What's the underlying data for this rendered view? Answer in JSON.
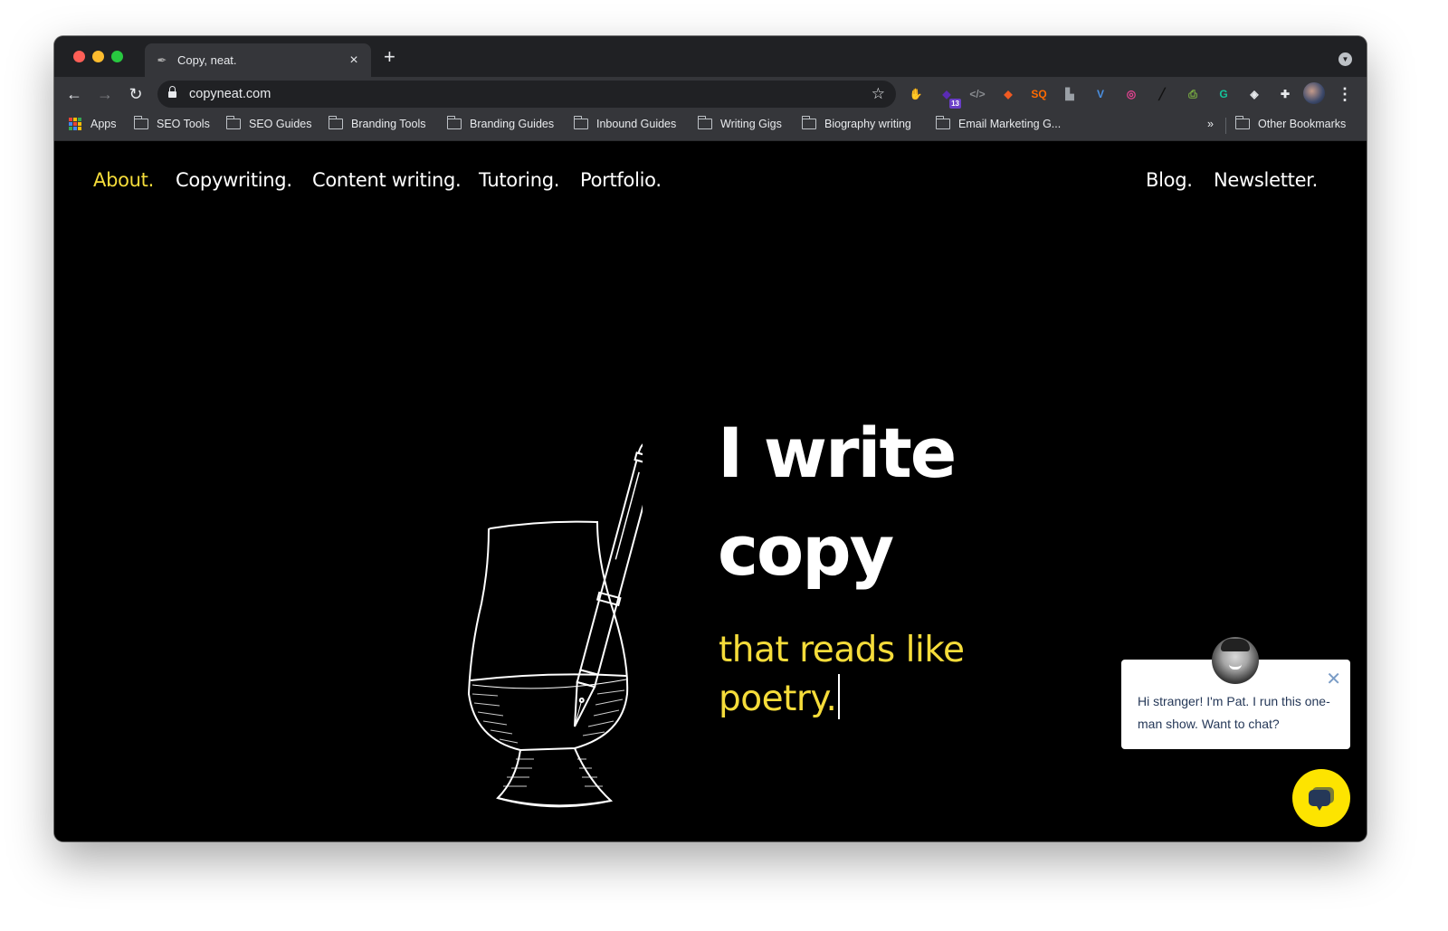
{
  "browser": {
    "tab": {
      "title": "Copy, neat.",
      "favicon": "pen-glass-icon",
      "close_label": "×"
    },
    "new_tab_label": "+",
    "address_bar": {
      "url": "copyneat.com",
      "secure": true
    },
    "nav": {
      "back": "←",
      "forward": "→",
      "reload": "↻"
    },
    "star_label": "☆",
    "extensions": [
      {
        "name": "adblock-icon",
        "glyph": "✋",
        "color": "#e0201b"
      },
      {
        "name": "stack-extension-icon",
        "glyph": "◆",
        "color": "#5b2bb5",
        "badge": "13"
      },
      {
        "name": "code-extension-icon",
        "glyph": "</>",
        "color": "#8a8d91"
      },
      {
        "name": "fox-extension-icon",
        "glyph": "◆",
        "color": "#f05a22"
      },
      {
        "name": "sq-extension-icon",
        "glyph": "SQ",
        "color": "#ff6a00"
      },
      {
        "name": "puzzle-blocks-icon",
        "glyph": "▙",
        "color": "#9aa0a6"
      },
      {
        "name": "v-extension-icon",
        "glyph": "V",
        "color": "#4a90e2"
      },
      {
        "name": "color-ring-icon",
        "glyph": "◎",
        "color": "#e84393"
      },
      {
        "name": "pen-extension-icon",
        "glyph": "╱",
        "color": "#111111"
      },
      {
        "name": "print-extension-icon",
        "glyph": "⎙",
        "color": "#7cb342"
      },
      {
        "name": "grammarly-icon",
        "glyph": "G",
        "color": "#15c39a"
      },
      {
        "name": "tag-extension-icon",
        "glyph": "◈",
        "color": "#e8eaed"
      },
      {
        "name": "extensions-puzzle-icon",
        "glyph": "✚",
        "color": "#e8eaed"
      }
    ],
    "menu_label": "⋮",
    "bookmarks": [
      {
        "label": "Apps",
        "type": "apps"
      },
      {
        "label": "SEO Tools",
        "type": "folder"
      },
      {
        "label": "SEO Guides",
        "type": "folder"
      },
      {
        "label": "Branding Tools",
        "type": "folder"
      },
      {
        "label": "Branding Guides",
        "type": "folder"
      },
      {
        "label": "Inbound Guides",
        "type": "folder"
      },
      {
        "label": "Writing Gigs",
        "type": "folder"
      },
      {
        "label": "Biography writing",
        "type": "folder"
      },
      {
        "label": "Email Marketing G...",
        "type": "folder"
      }
    ],
    "bookmarks_overflow": "»",
    "other_bookmarks": "Other Bookmarks"
  },
  "site": {
    "nav_left": [
      {
        "label": "About.",
        "active": true
      },
      {
        "label": "Copywriting.",
        "active": false
      },
      {
        "label": "Content writing.",
        "active": false
      },
      {
        "label": "Tutoring.",
        "active": false
      },
      {
        "label": "Portfolio.",
        "active": false
      }
    ],
    "nav_right": [
      {
        "label": "Blog."
      },
      {
        "label": "Newsletter."
      }
    ],
    "hero": {
      "title_line1": "I write",
      "title_line2": "copy",
      "subtitle_line1": "that reads like",
      "subtitle_line2": "poetry."
    },
    "accent_color": "#f5dc3a",
    "chat": {
      "message": "Hi stranger! I'm Pat. I run this one-man show. Want to chat?",
      "close_label": "✕",
      "launcher_color": "#fde400"
    }
  }
}
